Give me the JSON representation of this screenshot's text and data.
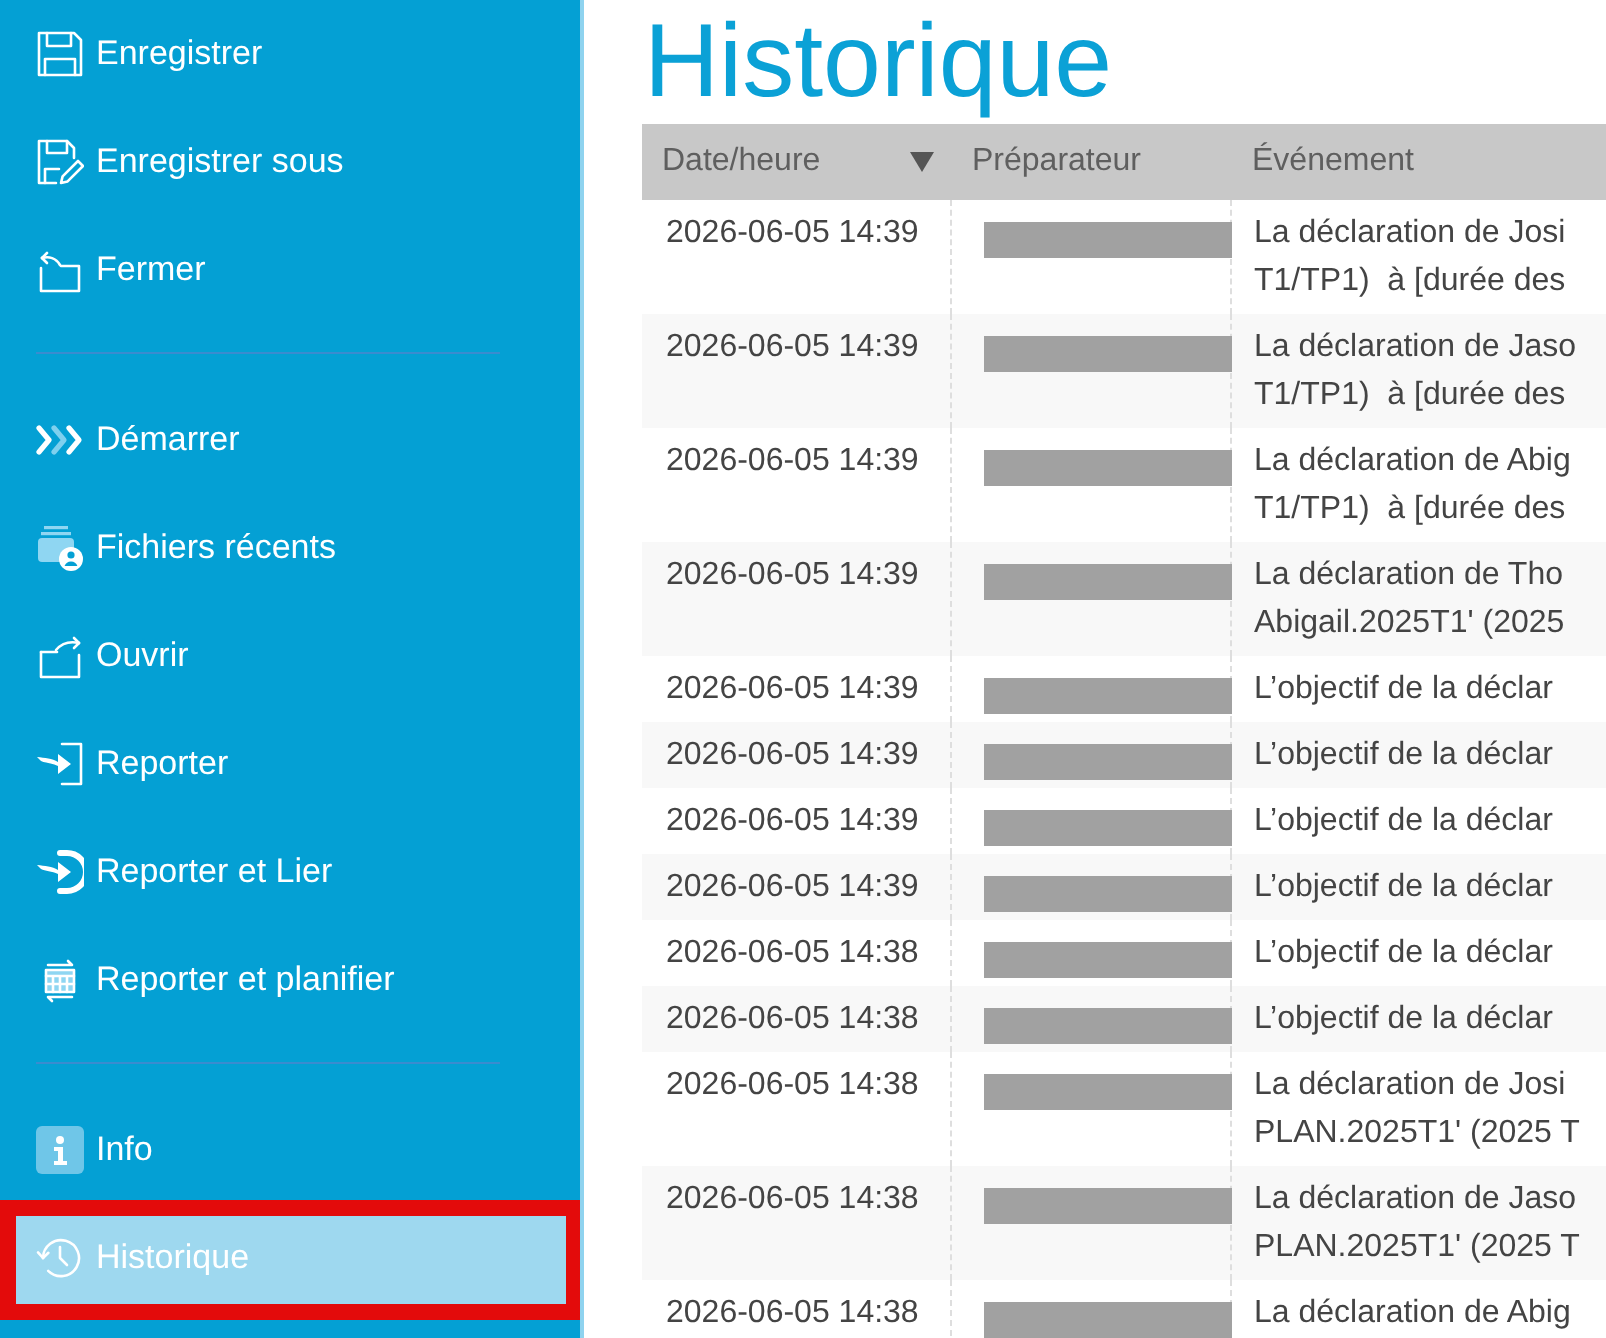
{
  "sidebar": {
    "groups": [
      {
        "items": [
          {
            "label": "Enregistrer",
            "selected": false,
            "highlighted": false
          },
          {
            "label": "Enregistrer sous",
            "selected": false,
            "highlighted": false
          },
          {
            "label": "Fermer",
            "selected": false,
            "highlighted": false
          }
        ]
      },
      {
        "items": [
          {
            "label": "Démarrer",
            "selected": false,
            "highlighted": false
          },
          {
            "label": "Fichiers récents",
            "selected": false,
            "highlighted": false
          },
          {
            "label": "Ouvrir",
            "selected": false,
            "highlighted": false
          },
          {
            "label": "Reporter",
            "selected": false,
            "highlighted": false
          },
          {
            "label": "Reporter et Lier",
            "selected": false,
            "highlighted": false
          },
          {
            "label": "Reporter et planifier",
            "selected": false,
            "highlighted": false
          }
        ]
      },
      {
        "items": [
          {
            "label": "Info",
            "selected": false,
            "highlighted": false
          },
          {
            "label": "Historique",
            "selected": true,
            "highlighted": true
          }
        ]
      }
    ]
  },
  "page": {
    "title": "Historique"
  },
  "table": {
    "columns": [
      {
        "label": "Date/heure",
        "sorted": true
      },
      {
        "label": "Préparateur",
        "sorted": false
      },
      {
        "label": "Événement",
        "sorted": false
      }
    ],
    "rows": [
      {
        "datetime": "2026-06-05 14:39",
        "preparer_redacted": true,
        "event": "La déclaration de Josi\nT1/TP1)  à [durée des"
      },
      {
        "datetime": "2026-06-05 14:39",
        "preparer_redacted": true,
        "event": "La déclaration de Jaso\nT1/TP1)  à [durée des"
      },
      {
        "datetime": "2026-06-05 14:39",
        "preparer_redacted": true,
        "event": "La déclaration de Abig\nT1/TP1)  à [durée des"
      },
      {
        "datetime": "2026-06-05 14:39",
        "preparer_redacted": true,
        "event": "La déclaration de Tho\nAbigail.2025T1' (2025"
      },
      {
        "datetime": "2026-06-05 14:39",
        "preparer_redacted": true,
        "event": "L’objectif de la déclar"
      },
      {
        "datetime": "2026-06-05 14:39",
        "preparer_redacted": true,
        "event": "L’objectif de la déclar"
      },
      {
        "datetime": "2026-06-05 14:39",
        "preparer_redacted": true,
        "event": "L’objectif de la déclar"
      },
      {
        "datetime": "2026-06-05 14:39",
        "preparer_redacted": true,
        "event": "L’objectif de la déclar"
      },
      {
        "datetime": "2026-06-05 14:38",
        "preparer_redacted": true,
        "event": "L’objectif de la déclar"
      },
      {
        "datetime": "2026-06-05 14:38",
        "preparer_redacted": true,
        "event": "L’objectif de la déclar"
      },
      {
        "datetime": "2026-06-05 14:38",
        "preparer_redacted": true,
        "event": "La déclaration de Josi\nPLAN.2025T1' (2025 T"
      },
      {
        "datetime": "2026-06-05 14:38",
        "preparer_redacted": true,
        "event": "La déclaration de Jaso\nPLAN.2025T1' (2025 T"
      },
      {
        "datetime": "2026-06-05 14:38",
        "preparer_redacted": true,
        "event": "La déclaration de Abig"
      }
    ]
  }
}
